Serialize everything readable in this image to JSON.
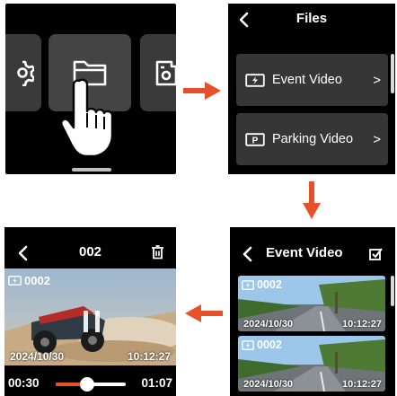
{
  "home": {
    "apps": [
      {
        "icon": "gear-icon"
      },
      {
        "icon": "folder-icon"
      },
      {
        "icon": "dashcam-icon"
      }
    ]
  },
  "files": {
    "title": "Files",
    "items": [
      {
        "label": "Event Video",
        "icon": "event-video-icon"
      },
      {
        "label": "Parking Video",
        "icon": "parking-icon"
      }
    ]
  },
  "event_list": {
    "title": "Event Video",
    "clips": [
      {
        "name": "0002",
        "date": "2024/10/30",
        "time": "10:12:27"
      },
      {
        "name": "0002",
        "date": "2024/10/30",
        "time": "10:12:27"
      }
    ]
  },
  "player": {
    "title": "002",
    "clip_name": "0002",
    "date": "2024/10/30",
    "time": "10:12:27",
    "elapsed": "00:30",
    "duration": "01:07",
    "progress_fraction": 0.45
  },
  "colors": {
    "accent": "#e8502a",
    "panel_bg": "#000000",
    "item_bg": "#363636"
  }
}
